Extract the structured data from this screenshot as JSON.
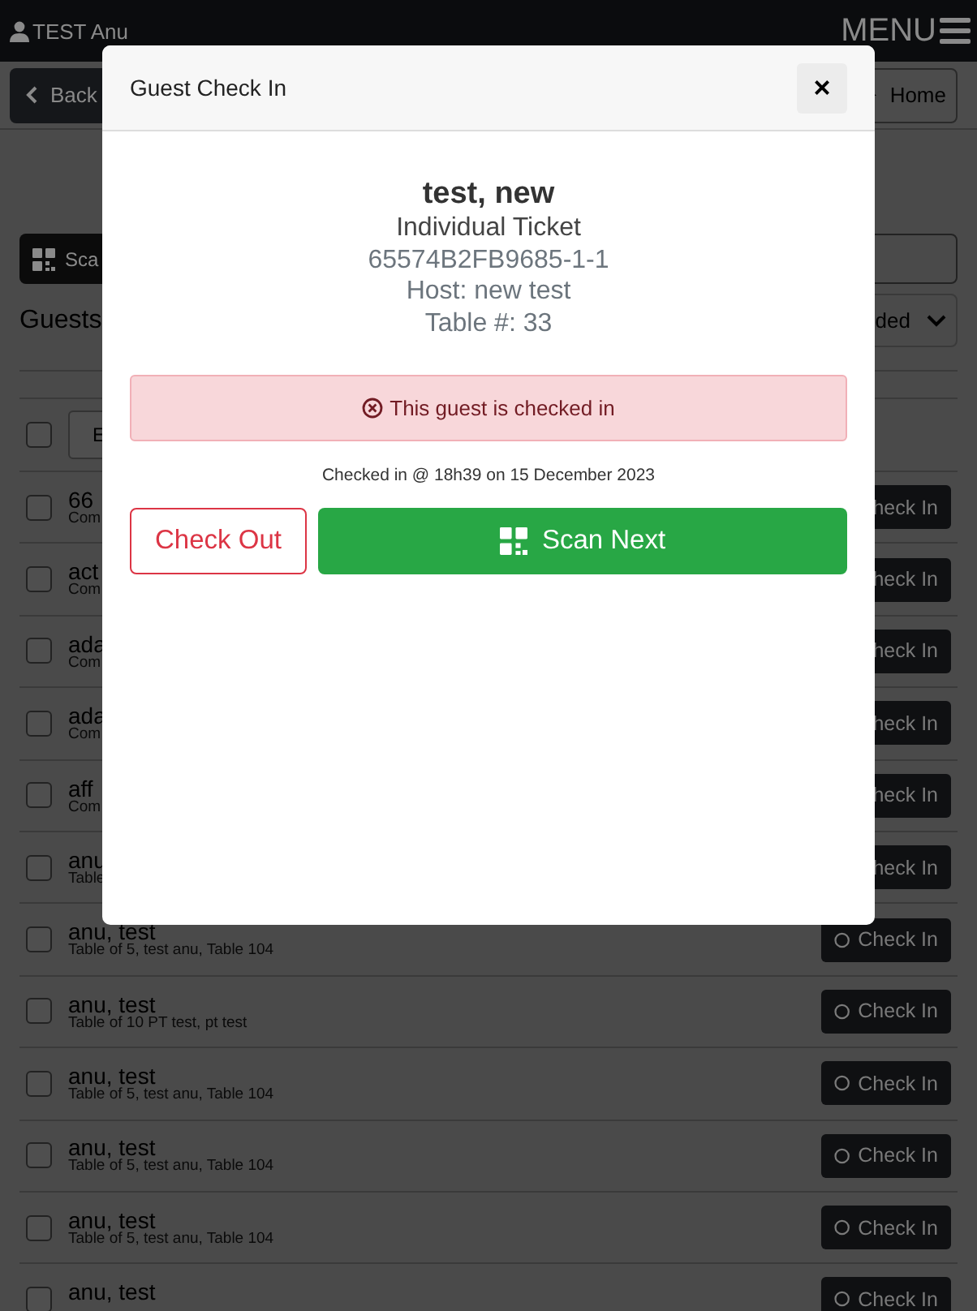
{
  "top_bar": {
    "user": "TEST Anu",
    "menu": "MENU"
  },
  "toolbar": {
    "back": "Back",
    "home": "Home"
  },
  "scan_button": "Sca",
  "guests_heading": "Guests",
  "filter": {
    "value": "ded"
  },
  "header_row": {
    "checked": false,
    "button": "E"
  },
  "guests": [
    {
      "name": "66",
      "detail": "Com",
      "checked": false,
      "button": {
        "label": "heck In",
        "icon": false
      }
    },
    {
      "name": "act",
      "detail": "Com",
      "checked": false,
      "button": {
        "label": "heck In",
        "icon": false
      }
    },
    {
      "name": "ada",
      "detail": "Com",
      "checked": false,
      "button": {
        "label": "heck In",
        "icon": false
      }
    },
    {
      "name": "ada",
      "detail": "Com",
      "checked": false,
      "button": {
        "label": "heck In",
        "icon": false
      }
    },
    {
      "name": "aff",
      "detail": "Com",
      "checked": false,
      "button": {
        "label": "heck In",
        "icon": false
      }
    },
    {
      "name": "anu",
      "detail": "Table",
      "checked": false,
      "button": {
        "label": "heck In",
        "icon": false
      }
    },
    {
      "name": "anu, test",
      "detail": "Table of 5, test anu, Table 104",
      "checked": false,
      "button": {
        "label": "Check In",
        "icon": true
      }
    },
    {
      "name": "anu, test",
      "detail": "Table of 10 PT test, pt test",
      "checked": false,
      "button": {
        "label": "Check In",
        "icon": true
      }
    },
    {
      "name": "anu, test",
      "detail": "Table of 5, test anu, Table 104",
      "checked": false,
      "button": {
        "label": "Check In",
        "icon": true
      }
    },
    {
      "name": "anu, test",
      "detail": "Table of 5, test anu, Table 104",
      "checked": false,
      "button": {
        "label": "Check In",
        "icon": true
      }
    },
    {
      "name": "anu, test",
      "detail": "Table of 5, test anu, Table 104",
      "checked": false,
      "button": {
        "label": "Check In",
        "icon": true
      }
    },
    {
      "name": "anu, test",
      "checked": false,
      "button": {
        "label": "Check In",
        "icon": true
      }
    }
  ],
  "modal": {
    "title": "Guest Check In",
    "close": "×",
    "guest_name": "test, new",
    "ticket_type": "Individual Ticket",
    "ticket_code": "65574B2FB9685-1-1",
    "host": "Host: new test",
    "table": "Table #: 33",
    "alert": {
      "kind": "danger",
      "text": "This guest is checked in"
    },
    "checked_in_time": "Checked in @ 18h39 on 15 December 2023",
    "buttons": [
      {
        "kind": "outline",
        "label": "Check Out"
      },
      {
        "kind": "scan",
        "label": "Scan Next"
      }
    ]
  }
}
